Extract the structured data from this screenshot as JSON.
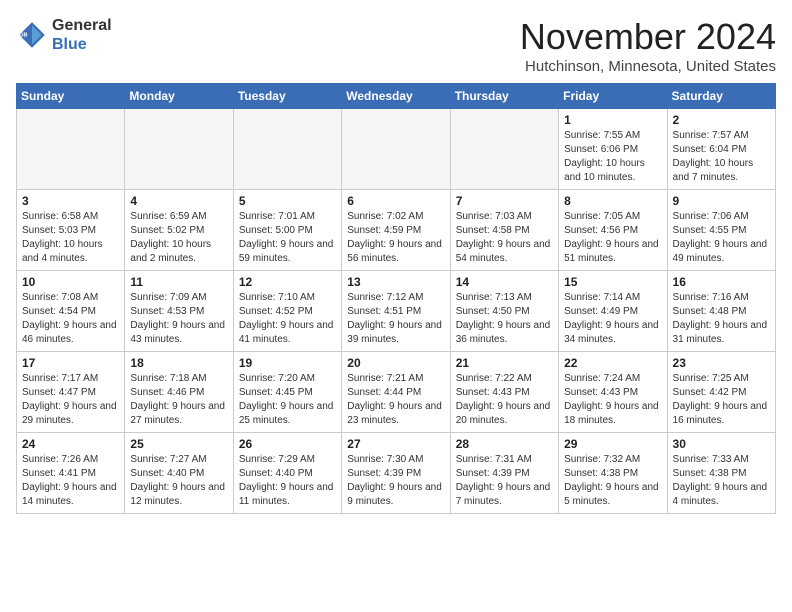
{
  "header": {
    "logo": {
      "general": "General",
      "blue": "Blue"
    },
    "title": "November 2024",
    "location": "Hutchinson, Minnesota, United States"
  },
  "days_of_week": [
    "Sunday",
    "Monday",
    "Tuesday",
    "Wednesday",
    "Thursday",
    "Friday",
    "Saturday"
  ],
  "weeks": [
    [
      {
        "day": "",
        "info": ""
      },
      {
        "day": "",
        "info": ""
      },
      {
        "day": "",
        "info": ""
      },
      {
        "day": "",
        "info": ""
      },
      {
        "day": "",
        "info": ""
      },
      {
        "day": "1",
        "info": "Sunrise: 7:55 AM\nSunset: 6:06 PM\nDaylight: 10 hours and 10 minutes."
      },
      {
        "day": "2",
        "info": "Sunrise: 7:57 AM\nSunset: 6:04 PM\nDaylight: 10 hours and 7 minutes."
      }
    ],
    [
      {
        "day": "3",
        "info": "Sunrise: 6:58 AM\nSunset: 5:03 PM\nDaylight: 10 hours and 4 minutes."
      },
      {
        "day": "4",
        "info": "Sunrise: 6:59 AM\nSunset: 5:02 PM\nDaylight: 10 hours and 2 minutes."
      },
      {
        "day": "5",
        "info": "Sunrise: 7:01 AM\nSunset: 5:00 PM\nDaylight: 9 hours and 59 minutes."
      },
      {
        "day": "6",
        "info": "Sunrise: 7:02 AM\nSunset: 4:59 PM\nDaylight: 9 hours and 56 minutes."
      },
      {
        "day": "7",
        "info": "Sunrise: 7:03 AM\nSunset: 4:58 PM\nDaylight: 9 hours and 54 minutes."
      },
      {
        "day": "8",
        "info": "Sunrise: 7:05 AM\nSunset: 4:56 PM\nDaylight: 9 hours and 51 minutes."
      },
      {
        "day": "9",
        "info": "Sunrise: 7:06 AM\nSunset: 4:55 PM\nDaylight: 9 hours and 49 minutes."
      }
    ],
    [
      {
        "day": "10",
        "info": "Sunrise: 7:08 AM\nSunset: 4:54 PM\nDaylight: 9 hours and 46 minutes."
      },
      {
        "day": "11",
        "info": "Sunrise: 7:09 AM\nSunset: 4:53 PM\nDaylight: 9 hours and 43 minutes."
      },
      {
        "day": "12",
        "info": "Sunrise: 7:10 AM\nSunset: 4:52 PM\nDaylight: 9 hours and 41 minutes."
      },
      {
        "day": "13",
        "info": "Sunrise: 7:12 AM\nSunset: 4:51 PM\nDaylight: 9 hours and 39 minutes."
      },
      {
        "day": "14",
        "info": "Sunrise: 7:13 AM\nSunset: 4:50 PM\nDaylight: 9 hours and 36 minutes."
      },
      {
        "day": "15",
        "info": "Sunrise: 7:14 AM\nSunset: 4:49 PM\nDaylight: 9 hours and 34 minutes."
      },
      {
        "day": "16",
        "info": "Sunrise: 7:16 AM\nSunset: 4:48 PM\nDaylight: 9 hours and 31 minutes."
      }
    ],
    [
      {
        "day": "17",
        "info": "Sunrise: 7:17 AM\nSunset: 4:47 PM\nDaylight: 9 hours and 29 minutes."
      },
      {
        "day": "18",
        "info": "Sunrise: 7:18 AM\nSunset: 4:46 PM\nDaylight: 9 hours and 27 minutes."
      },
      {
        "day": "19",
        "info": "Sunrise: 7:20 AM\nSunset: 4:45 PM\nDaylight: 9 hours and 25 minutes."
      },
      {
        "day": "20",
        "info": "Sunrise: 7:21 AM\nSunset: 4:44 PM\nDaylight: 9 hours and 23 minutes."
      },
      {
        "day": "21",
        "info": "Sunrise: 7:22 AM\nSunset: 4:43 PM\nDaylight: 9 hours and 20 minutes."
      },
      {
        "day": "22",
        "info": "Sunrise: 7:24 AM\nSunset: 4:43 PM\nDaylight: 9 hours and 18 minutes."
      },
      {
        "day": "23",
        "info": "Sunrise: 7:25 AM\nSunset: 4:42 PM\nDaylight: 9 hours and 16 minutes."
      }
    ],
    [
      {
        "day": "24",
        "info": "Sunrise: 7:26 AM\nSunset: 4:41 PM\nDaylight: 9 hours and 14 minutes."
      },
      {
        "day": "25",
        "info": "Sunrise: 7:27 AM\nSunset: 4:40 PM\nDaylight: 9 hours and 12 minutes."
      },
      {
        "day": "26",
        "info": "Sunrise: 7:29 AM\nSunset: 4:40 PM\nDaylight: 9 hours and 11 minutes."
      },
      {
        "day": "27",
        "info": "Sunrise: 7:30 AM\nSunset: 4:39 PM\nDaylight: 9 hours and 9 minutes."
      },
      {
        "day": "28",
        "info": "Sunrise: 7:31 AM\nSunset: 4:39 PM\nDaylight: 9 hours and 7 minutes."
      },
      {
        "day": "29",
        "info": "Sunrise: 7:32 AM\nSunset: 4:38 PM\nDaylight: 9 hours and 5 minutes."
      },
      {
        "day": "30",
        "info": "Sunrise: 7:33 AM\nSunset: 4:38 PM\nDaylight: 9 hours and 4 minutes."
      }
    ]
  ]
}
